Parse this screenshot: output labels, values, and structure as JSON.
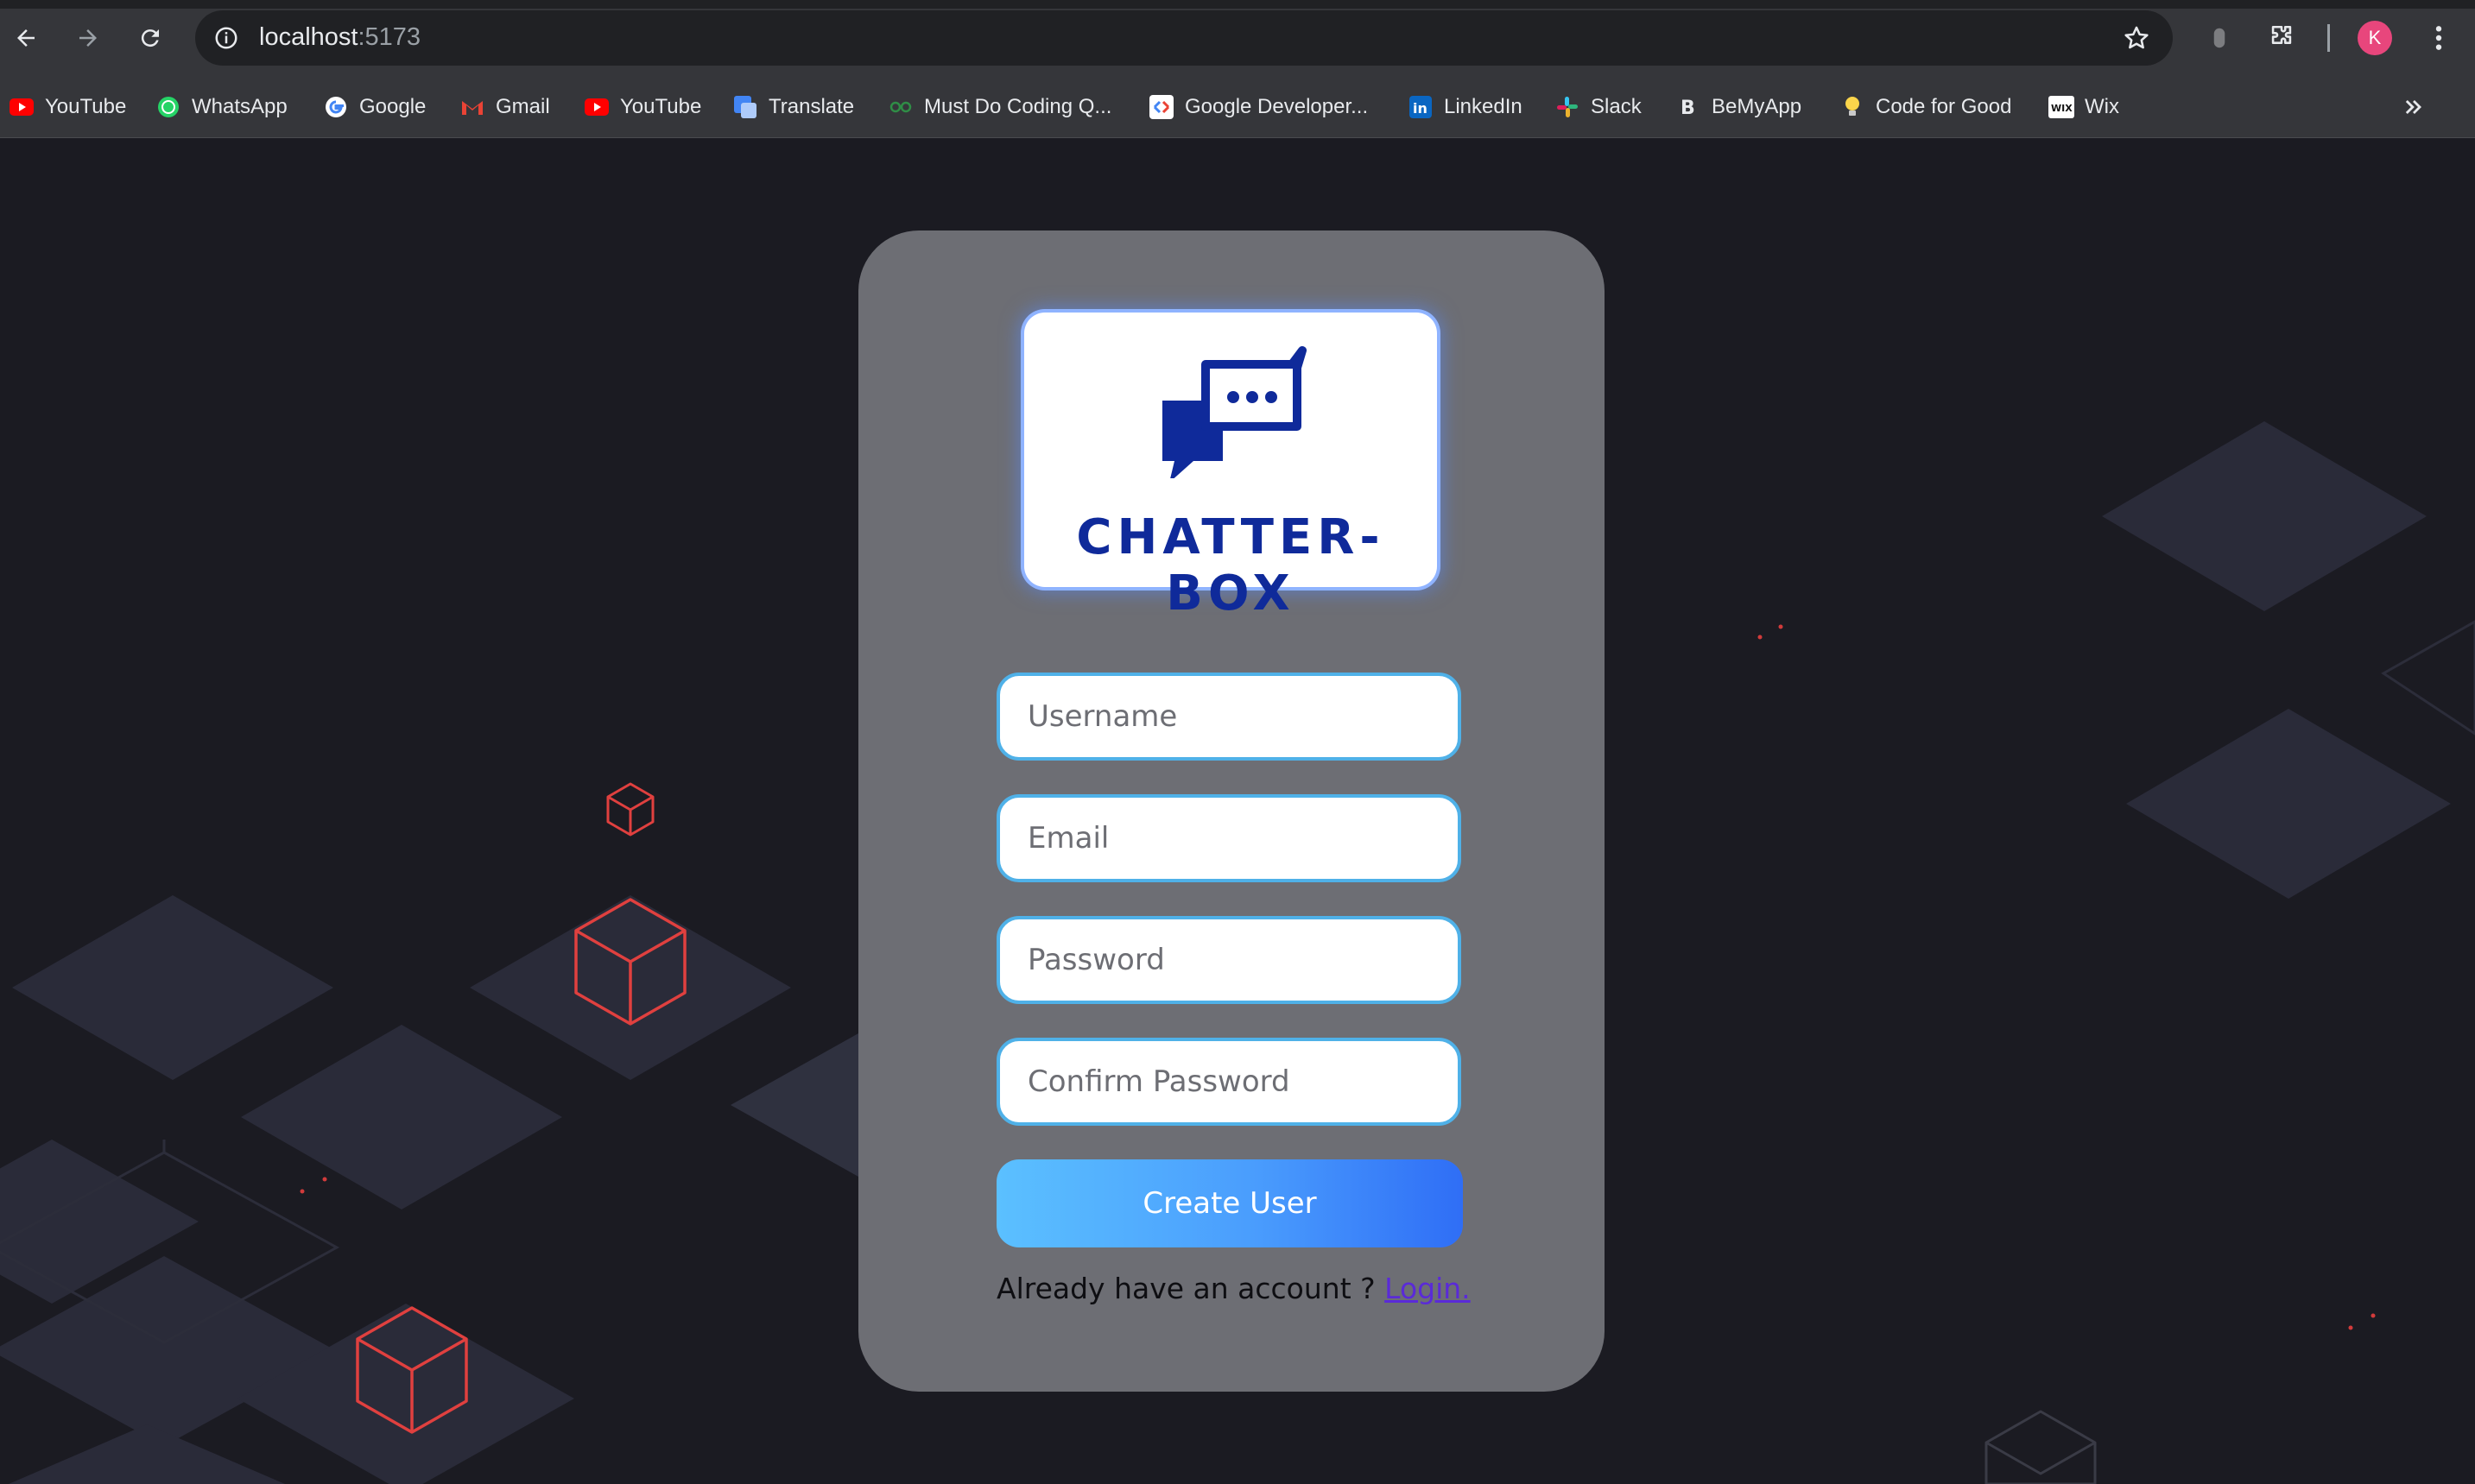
{
  "browser": {
    "url_host": "localhost",
    "url_port": ":5173",
    "profile_initial": "K",
    "bookmarks": [
      {
        "label": "YouTube",
        "icon": "youtube-icon"
      },
      {
        "label": "WhatsApp",
        "icon": "whatsapp-icon"
      },
      {
        "label": "Google",
        "icon": "google-icon"
      },
      {
        "label": "Gmail",
        "icon": "gmail-icon"
      },
      {
        "label": "YouTube",
        "icon": "youtube-icon"
      },
      {
        "label": "Translate",
        "icon": "translate-icon"
      },
      {
        "label": "Must Do Coding Q...",
        "icon": "geeksforgeeks-icon"
      },
      {
        "label": "Google Developer...",
        "icon": "google-developers-icon"
      },
      {
        "label": "LinkedIn",
        "icon": "linkedin-icon"
      },
      {
        "label": "Slack",
        "icon": "slack-icon"
      },
      {
        "label": "BeMyApp",
        "icon": "bemyapp-icon"
      },
      {
        "label": "Code for Good",
        "icon": "lightbulb-icon"
      },
      {
        "label": "Wix",
        "icon": "wix-icon"
      }
    ]
  },
  "app": {
    "logo_text": "CHATTER-BOX",
    "form": {
      "username_placeholder": "Username",
      "email_placeholder": "Email",
      "password_placeholder": "Password",
      "confirm_password_placeholder": "Confirm Password",
      "submit_label": "Create User"
    },
    "footer": {
      "prompt": "Already have an account ? ",
      "login_link": "Login."
    }
  },
  "colors": {
    "page_background": "#1b1b22",
    "card_background": "#6d6e74",
    "brand_blue": "#0f2a9a",
    "input_border": "#4fb1e8",
    "button_gradient_start": "#5bc0ff",
    "button_gradient_end": "#2f6ef6",
    "link": "#5a2ad8",
    "decor_cube": "#e0403f"
  }
}
